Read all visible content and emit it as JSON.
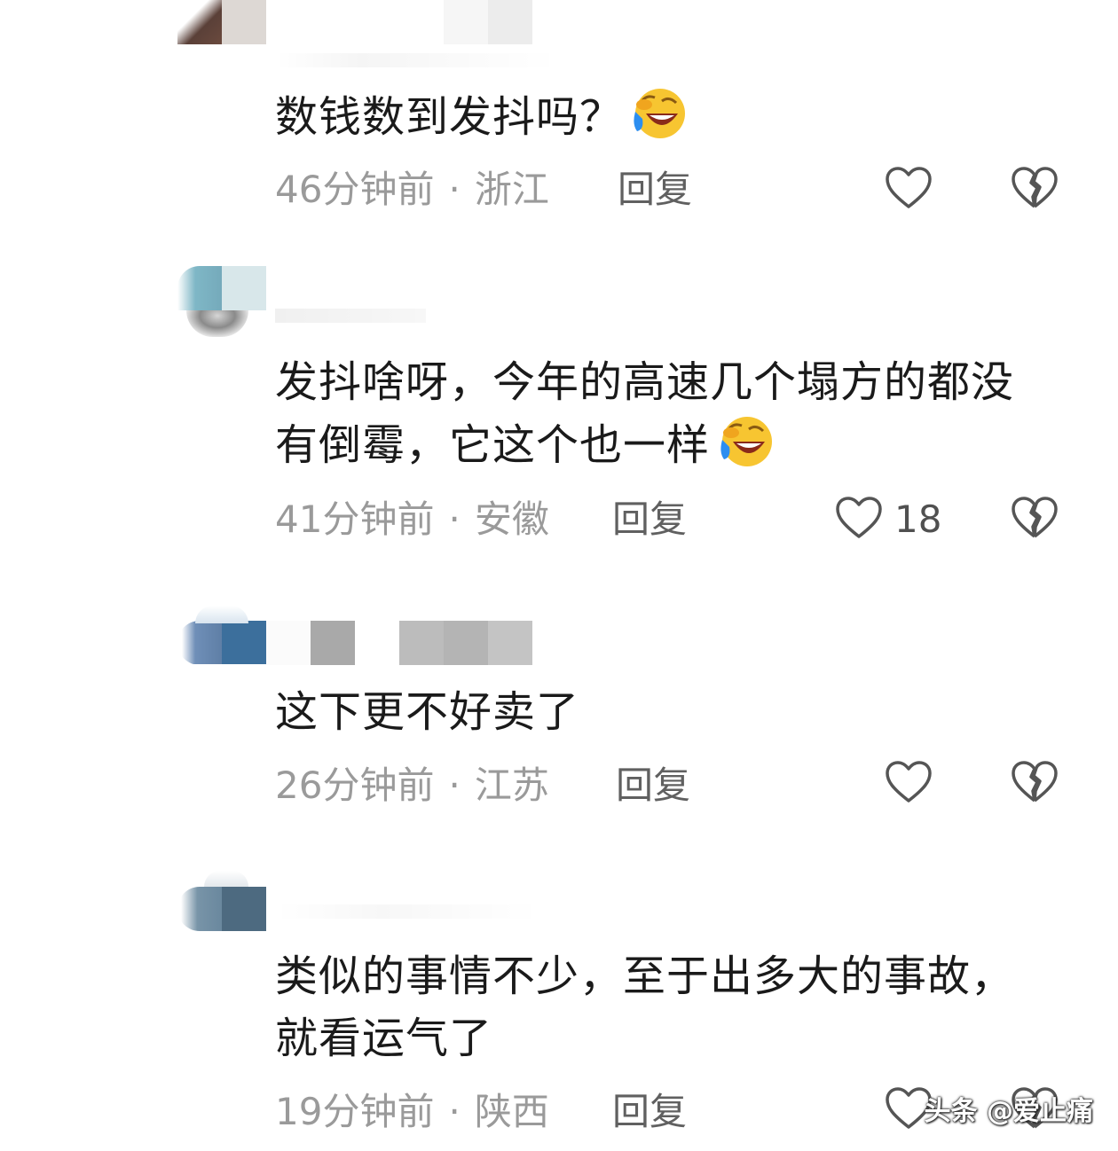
{
  "comments": [
    {
      "text": "数钱数到发抖吗？",
      "has_emoji": true,
      "time": "46分钟前",
      "location": "浙江",
      "reply_label": "回复",
      "likes": ""
    },
    {
      "text": "发抖啥呀，今年的高速几个塌方的都没\n有倒霉，它这个也一样",
      "has_emoji": true,
      "time": "41分钟前",
      "location": "安徽",
      "reply_label": "回复",
      "likes": "18"
    },
    {
      "text": "这下更不好卖了",
      "has_emoji": false,
      "time": "26分钟前",
      "location": "江苏",
      "reply_label": "回复",
      "likes": ""
    },
    {
      "text": "类似的事情不少，至于出多大的事故，\n就看运气了",
      "has_emoji": false,
      "time": "19分钟前",
      "location": "陕西",
      "reply_label": "回复",
      "likes": ""
    }
  ],
  "separator": "·",
  "watermark": "头条 @爱止痛",
  "icons": {
    "like": "heart-outline-icon",
    "dislike": "broken-heart-icon",
    "emoji": "laughing-crying-emoji-icon"
  },
  "colors": {
    "text": "#1a1a1a",
    "meta": "#9a9a9a",
    "reply": "#606060",
    "icon": "#555555"
  }
}
